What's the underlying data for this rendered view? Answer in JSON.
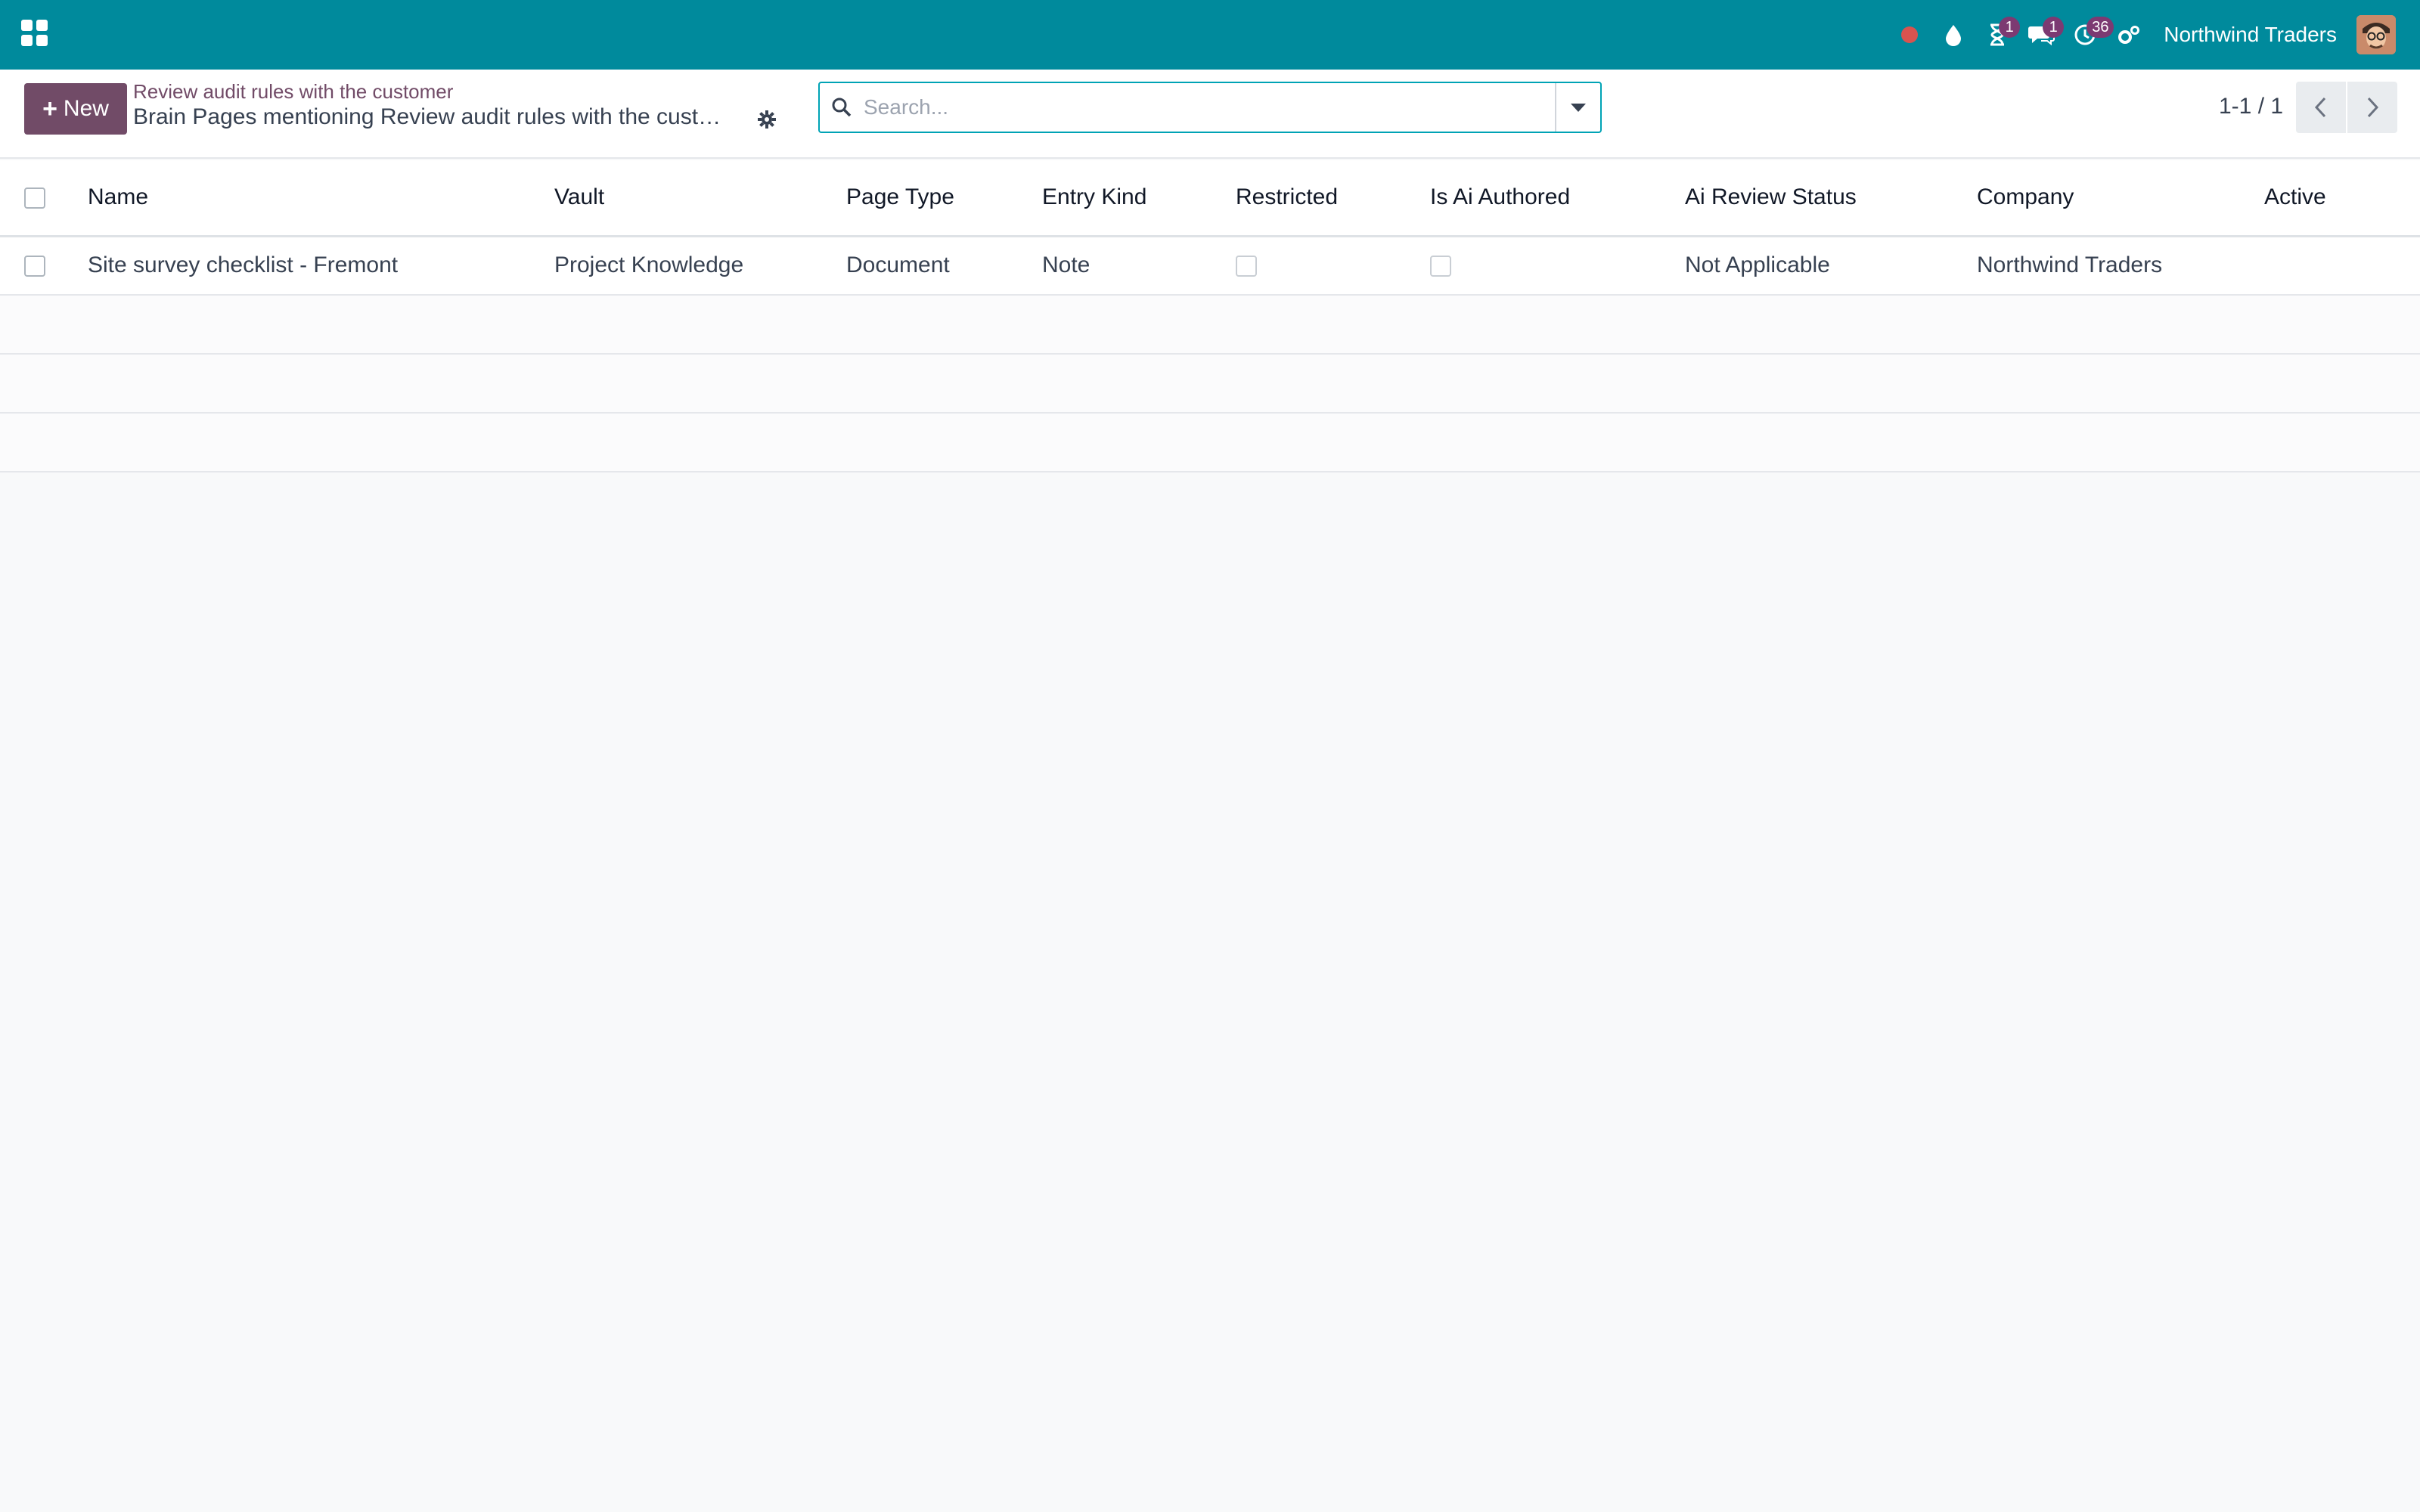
{
  "navbar": {
    "company": "Northwind Traders",
    "badges": {
      "activities": "1",
      "messages": "1",
      "timesheet": "36"
    },
    "colors": {
      "bar": "#008a9c",
      "badge": "#7c3a72",
      "record": "#d9534f"
    }
  },
  "control_panel": {
    "new_label": "New",
    "breadcrumb_parent": "Review audit rules with the customer",
    "breadcrumb_current": "Brain Pages mentioning Review audit rules with the customer",
    "search_placeholder": "Search...",
    "pager": "1-1 / 1",
    "accent": "#714b67"
  },
  "table": {
    "columns": [
      "Name",
      "Vault",
      "Page Type",
      "Entry Kind",
      "Restricted",
      "Is Ai Authored",
      "Ai Review Status",
      "Company",
      "Active"
    ],
    "rows": [
      {
        "name": "Site survey checklist - Fremont",
        "vault": "Project Knowledge",
        "page_type": "Document",
        "entry_kind": "Note",
        "restricted": false,
        "is_ai_authored": false,
        "ai_review_status": "Not Applicable",
        "company": "Northwind Traders",
        "active": ""
      }
    ]
  }
}
